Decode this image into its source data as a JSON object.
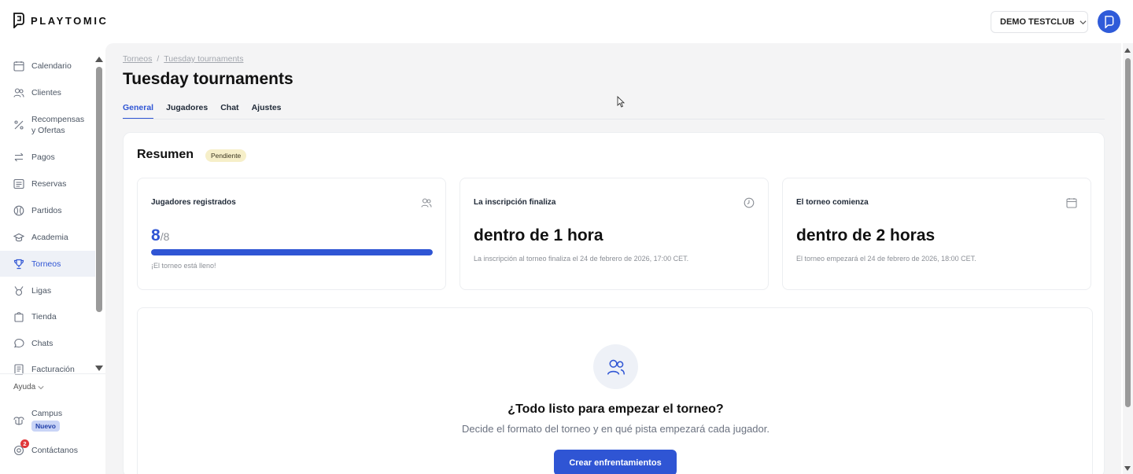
{
  "brand": {
    "name": "PLAYTOMIC"
  },
  "header": {
    "club_name": "DEMO TESTCLUB"
  },
  "sidebar": {
    "items": [
      {
        "label": "Calendario",
        "icon": "calendar-icon"
      },
      {
        "label": "Clientes",
        "icon": "users-icon"
      },
      {
        "label": "Recompensas y Ofertas",
        "icon": "percent-icon"
      },
      {
        "label": "Pagos",
        "icon": "transfer-icon"
      },
      {
        "label": "Reservas",
        "icon": "list-icon"
      },
      {
        "label": "Partidos",
        "icon": "ball-icon"
      },
      {
        "label": "Academia",
        "icon": "graduation-cap-icon"
      },
      {
        "label": "Torneos",
        "icon": "trophy-icon",
        "active": true
      },
      {
        "label": "Ligas",
        "icon": "medal-icon"
      },
      {
        "label": "Tienda",
        "icon": "shopping-bag-icon"
      },
      {
        "label": "Chats",
        "icon": "chat-icon"
      },
      {
        "label": "Facturación",
        "icon": "invoice-icon"
      }
    ],
    "help_label": "Ayuda",
    "campus_label": "Campus",
    "campus_badge": "Nuevo",
    "contact_label": "Contáctanos",
    "contact_notifications": "2"
  },
  "breadcrumb": {
    "root": "Torneos",
    "separator": "/",
    "current": "Tuesday tournaments"
  },
  "page": {
    "title": "Tuesday tournaments"
  },
  "tabs": [
    "General",
    "Jugadores",
    "Chat",
    "Ajustes"
  ],
  "active_tab": "General",
  "summary": {
    "title": "Resumen",
    "status": "Pendiente",
    "players": {
      "label": "Jugadores registrados",
      "registered": "8",
      "max": "/8",
      "fill_fraction": 1.0,
      "note": "¡El torneo está lleno!"
    },
    "registration": {
      "label": "La inscripción finaliza",
      "value": "dentro de 1 hora",
      "note": "La inscripción al torneo finaliza el 24 de febrero de 2026, 17:00 CET."
    },
    "start": {
      "label": "El torneo comienza",
      "value": "dentro de 2 horas",
      "note": "El torneo empezará el 24 de febrero de 2026, 18:00 CET."
    }
  },
  "empty_state": {
    "title": "¿Todo listo para empezar el torneo?",
    "subtitle": "Decide el formato del torneo y en qué pista empezará cada jugador.",
    "button": "Crear enfrentamientos"
  },
  "colors": {
    "accent": "#2f55d4",
    "badge_pending": "#f6efc9",
    "notification": "#e0383a"
  }
}
